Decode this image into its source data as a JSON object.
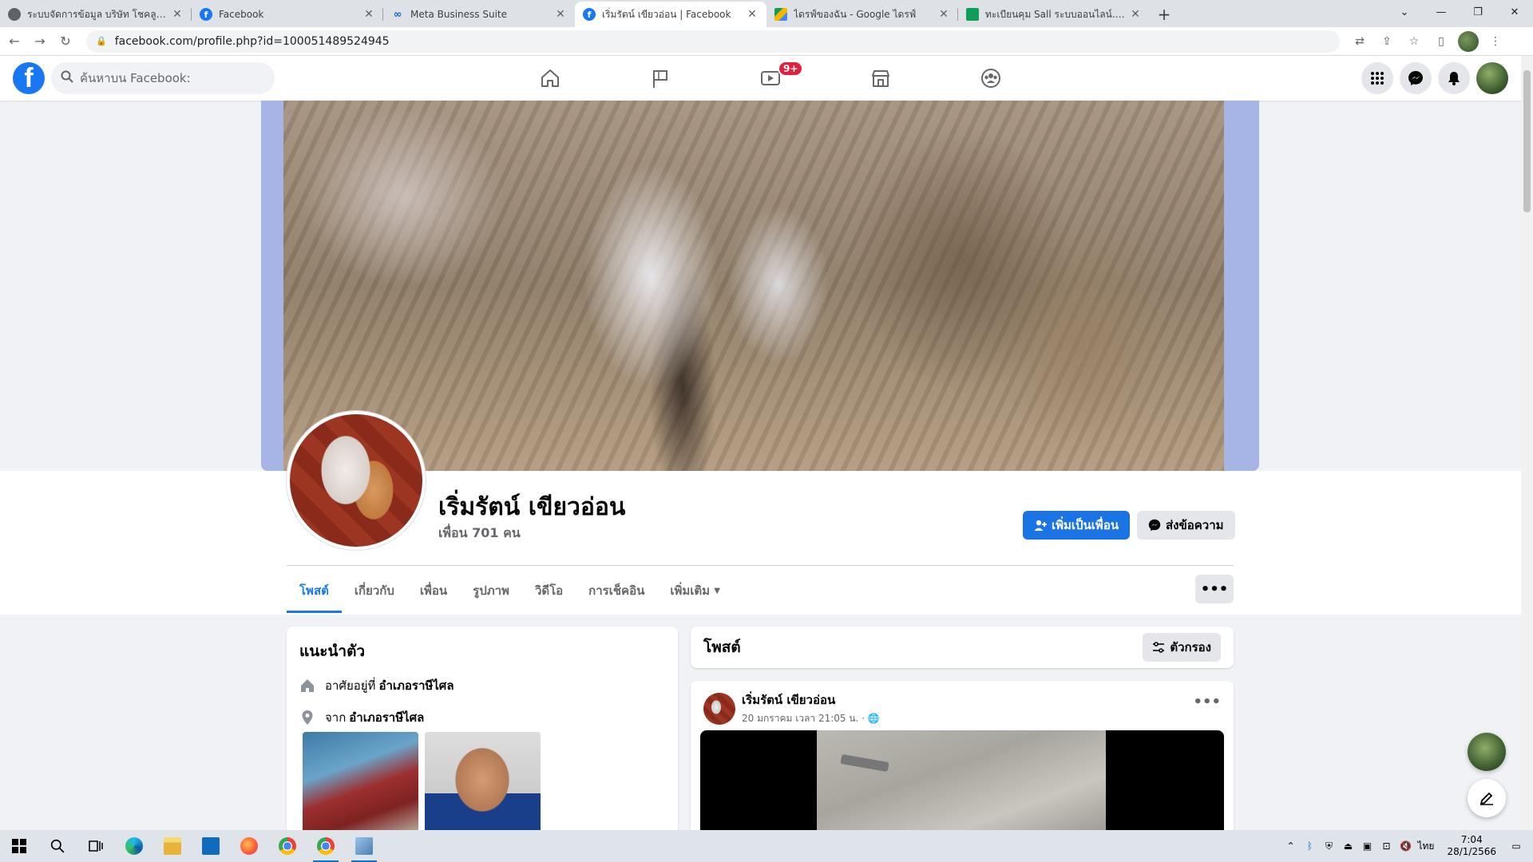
{
  "browser": {
    "tabs": [
      {
        "title": "ระบบจัดการข้อมูล บริษัท โชคลูกน็อต",
        "favicon": "globe"
      },
      {
        "title": "Facebook",
        "favicon": "fb"
      },
      {
        "title": "Meta Business Suite",
        "favicon": "meta"
      },
      {
        "title": "เริ่มรัตน์ เขียวอ่อน | Facebook",
        "favicon": "fb",
        "active": true
      },
      {
        "title": "ไดรฟ์ของฉัน - Google ไดรฟ์",
        "favicon": "drive"
      },
      {
        "title": "ทะเบียนคุม Sall ระบบออนไลน์.xlsx - Go",
        "favicon": "sheet"
      }
    ],
    "url": "facebook.com/profile.php?id=100051489524945"
  },
  "fb_header": {
    "search_placeholder": "ค้นหาบน Facebook:",
    "video_badge": "9+"
  },
  "profile": {
    "name": "เริ่มรัตน์ เขียวอ่อน",
    "friends": "เพื่อน 701 คน",
    "add_friend_label": "เพิ่มเป็นเพื่อน",
    "message_label": "ส่งข้อความ"
  },
  "profile_tabs": [
    {
      "label": "โพสต์",
      "active": true
    },
    {
      "label": "เกี่ยวกับ"
    },
    {
      "label": "เพื่อน"
    },
    {
      "label": "รูปภาพ"
    },
    {
      "label": "วิดีโอ"
    },
    {
      "label": "การเช็คอิน"
    },
    {
      "label": "เพิ่มเติม"
    }
  ],
  "intro": {
    "title": "แนะนำตัว",
    "lives_prefix": "อาศัยอยู่ที่",
    "lives_place": "อำเภอราษีไศล",
    "from_prefix": "จาก",
    "from_place": "อำเภอราษีไศล"
  },
  "posts": {
    "title": "โพสต์",
    "filter_label": "ตัวกรอง",
    "first_post": {
      "author": "เริ่มรัตน์ เขียวอ่อน",
      "time": "20 มกราคม เวลา 21:05 น. ·"
    }
  },
  "taskbar": {
    "lang": "ไทย",
    "time": "7:04",
    "date": "28/1/2566"
  },
  "colors": {
    "fb_blue": "#1877f2",
    "badge_red": "#e41e3f"
  }
}
